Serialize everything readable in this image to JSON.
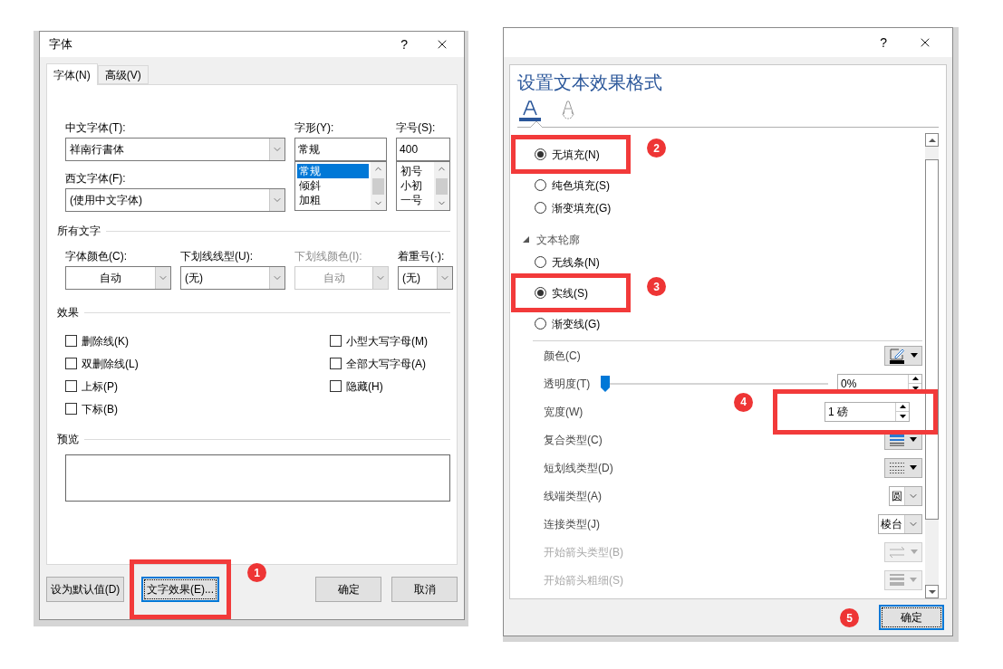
{
  "font_dialog": {
    "title": "字体",
    "help": "?",
    "tabs": [
      {
        "label": "字体(N)",
        "selected": true
      },
      {
        "label": "高级(V)",
        "selected": false
      }
    ],
    "chinese_font": {
      "label": "中文字体(T):",
      "value": "祥南行書体"
    },
    "western_font": {
      "label": "西文字体(F):",
      "value": "(使用中文字体)"
    },
    "style": {
      "label": "字形(Y):",
      "value": "常规",
      "options": [
        {
          "label": "常规",
          "selected": true
        },
        {
          "label": "倾斜",
          "selected": false
        },
        {
          "label": "加粗",
          "selected": false
        }
      ]
    },
    "size": {
      "label": "字号(S):",
      "value": "400",
      "options": [
        {
          "label": "初号",
          "selected": false
        },
        {
          "label": "小初",
          "selected": false
        },
        {
          "label": "一号",
          "selected": false
        }
      ]
    },
    "all_text": {
      "title": "所有文字",
      "fields": [
        {
          "kind": "color",
          "label": "字体颜色(C):",
          "value": "自动",
          "disabled": false
        },
        {
          "kind": "dropdown",
          "label": "下划线线型(U):",
          "value": "(无)",
          "disabled": false
        },
        {
          "kind": "color",
          "label": "下划线颜色(I):",
          "value": "自动",
          "disabled": true
        },
        {
          "kind": "dropdown",
          "label": "着重号(·):",
          "value": "(无)",
          "disabled": false
        }
      ]
    },
    "effects": {
      "title": "效果",
      "columns": [
        [
          {
            "label": "删除线(K)",
            "checked": false
          },
          {
            "label": "双删除线(L)",
            "checked": false
          },
          {
            "label": "上标(P)",
            "checked": false
          },
          {
            "label": "下标(B)",
            "checked": false
          }
        ],
        [
          {
            "label": "小型大写字母(M)",
            "checked": false
          },
          {
            "label": "全部大写字母(A)",
            "checked": false
          },
          {
            "label": "隐藏(H)",
            "checked": false
          }
        ]
      ]
    },
    "preview": {
      "title": "预览"
    },
    "buttons": [
      {
        "label": "设为默认值(D)",
        "focused": false
      },
      {
        "label": "文字效果(E)...",
        "focused": true,
        "callout": {
          "number": "1",
          "boxed": true
        }
      },
      {
        "label": "确定",
        "focused": false
      },
      {
        "label": "取消",
        "focused": false
      }
    ]
  },
  "effects_dialog": {
    "help": "?",
    "heading": "设置文本效果格式",
    "tabs": [
      {
        "kind": "fill_outline",
        "selected": true
      },
      {
        "kind": "text_effects",
        "selected": false
      }
    ],
    "fill": {
      "options": [
        {
          "label": "无填充(N)",
          "selected": true,
          "callout": {
            "number": "2",
            "boxed": true
          }
        },
        {
          "label": "纯色填充(S)",
          "selected": false
        },
        {
          "label": "渐变填充(G)",
          "selected": false
        }
      ]
    },
    "outline": {
      "title": "文本轮廓",
      "expanded": true,
      "options": [
        {
          "label": "无线条(N)",
          "selected": false
        },
        {
          "label": "实线(S)",
          "selected": true,
          "callout": {
            "number": "3",
            "boxed": true
          }
        },
        {
          "label": "渐变线(G)",
          "selected": false
        }
      ],
      "properties": [
        {
          "kind": "color_button",
          "label": "颜色(C)",
          "disabled": false
        },
        {
          "kind": "slider",
          "label": "透明度(T)",
          "level": 0,
          "value": "0%",
          "disabled": false
        },
        {
          "kind": "spinner",
          "label": "宽度(W)",
          "value": "1 磅",
          "disabled": false,
          "callout": {
            "number": "4",
            "boxed": true
          }
        },
        {
          "kind": "compound_button",
          "label": "复合类型(C)",
          "disabled": false
        },
        {
          "kind": "dash_button",
          "label": "短划线类型(D)",
          "disabled": false
        },
        {
          "kind": "select",
          "label": "线端类型(A)",
          "value": "圆",
          "disabled": false
        },
        {
          "kind": "select",
          "label": "连接类型(J)",
          "value": "棱台",
          "disabled": false
        },
        {
          "kind": "arrow_button",
          "label": "开始箭头类型(B)",
          "disabled": true
        },
        {
          "kind": "weight_button",
          "label": "开始箭头粗细(S)",
          "disabled": true
        }
      ]
    },
    "buttons": [
      {
        "label": "确定",
        "focused": true,
        "callout": {
          "number": "5",
          "boxed": false
        }
      }
    ]
  }
}
